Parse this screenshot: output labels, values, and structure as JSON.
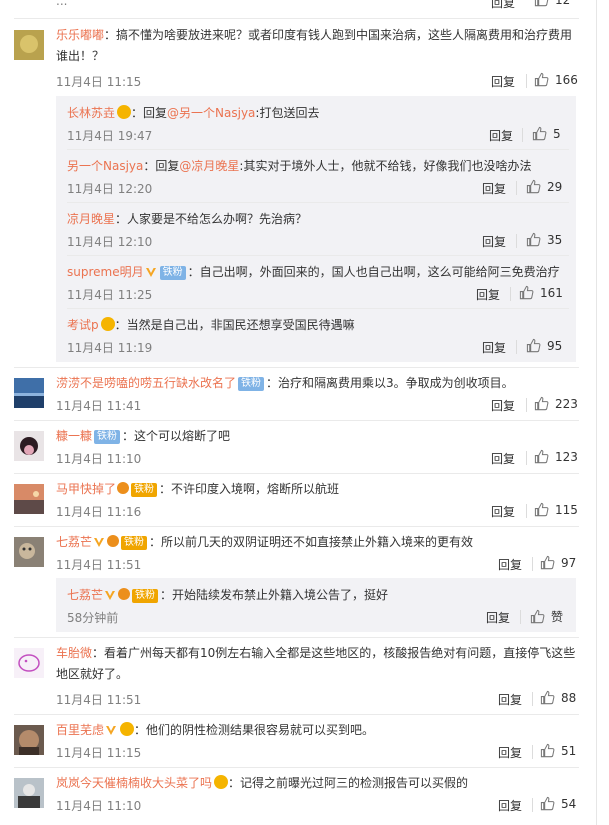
{
  "top_fragment": {
    "time": "...",
    "reply": "回复",
    "likes": "12"
  },
  "comments": [
    {
      "name": "乐乐嘟嘟",
      "text1": "：搞不懂为啥要放进来呢？或者印度有钱人跑到中国来治病，这些人隔离费用和治疗费用",
      "text2": "谁出！？",
      "time": "11月4日 11:15",
      "reply": "回复",
      "likes": "166"
    },
    {
      "name": "长林苏垚",
      "reply_prefix": "：回复",
      "at": "@另一个Nasjya",
      "text": ":打包送回去",
      "time": "11月4日 19:47",
      "reply": "回复",
      "likes": "5"
    },
    {
      "name": "另一个Nasjya",
      "reply_prefix": "：回复",
      "at": "@凉月晚星",
      "text": ":其实对于境外人士，他就不给钱，好像我们也没啥办法",
      "time": "11月4日 12:20",
      "reply": "回复",
      "likes": "29"
    },
    {
      "name": "凉月晚星",
      "text": "：人家要是不给怎么办啊？先治病？",
      "time": "11月4日 12:10",
      "reply": "回复",
      "likes": "35"
    },
    {
      "name": "supreme明月",
      "badge": "铁粉",
      "text": "：自己出啊，外面回来的，国人也自己出啊，这么可能给阿三免费治疗",
      "time": "11月4日 11:25",
      "reply": "回复",
      "likes": "161"
    },
    {
      "name": "考试p",
      "text": "：当然是自己出，非国民还想享受国民待遇嘛",
      "time": "11月4日 11:19",
      "reply": "回复",
      "likes": "95"
    },
    {
      "name": "涝涝不是唠嗑的唠五行缺水改名了",
      "badge": "铁粉",
      "text": "：治疗和隔离费用乘以3。争取成为创收项目。",
      "time": "11月4日 11:41",
      "reply": "回复",
      "likes": "223"
    },
    {
      "name": "糠一糠",
      "badge": "铁粉",
      "text": "：这个可以熔断了吧",
      "time": "11月4日 11:10",
      "reply": "回复",
      "likes": "123"
    },
    {
      "name": "马甲快掉了",
      "badge": "铁粉",
      "text": "：不许印度入境啊，熔断所以航班",
      "time": "11月4日 11:16",
      "reply": "回复",
      "likes": "115"
    },
    {
      "name": "七荔芒",
      "badge": "铁粉",
      "text": "：所以前几天的双阴证明还不如直接禁止外籍入境来的更有效",
      "time": "11月4日 11:51",
      "reply": "回复",
      "likes": "97"
    },
    {
      "name": "七荔芒",
      "badge": "铁粉",
      "text": "：开始陆续发布禁止外籍入境公告了，挺好",
      "time": "58分钟前",
      "reply": "回复",
      "likes": "赞"
    },
    {
      "name": "车胎微",
      "text1": "：看着广州每天都有10例左右输入全都是这些地区的，核酸报告绝对有问题，直接停飞这些",
      "text2": "地区就好了。",
      "time": "11月4日 11:51",
      "reply": "回复",
      "likes": "88"
    },
    {
      "name": "百里芜虑",
      "text": "：他们的阴性检测结果很容易就可以买到吧。",
      "time": "11月4日 11:15",
      "reply": "回复",
      "likes": "51"
    },
    {
      "name": "岚岚今天催楠楠收大头菜了吗",
      "text": "：记得之前曝光过阿三的检测报告可以买假的",
      "time": "11月4日 11:10",
      "reply": "回复",
      "likes": "54"
    }
  ],
  "colors": {
    "name": "#eb7350",
    "time": "#808080",
    "subbox": "#f2f2f5",
    "fan_badge": "#7fb3e6"
  }
}
